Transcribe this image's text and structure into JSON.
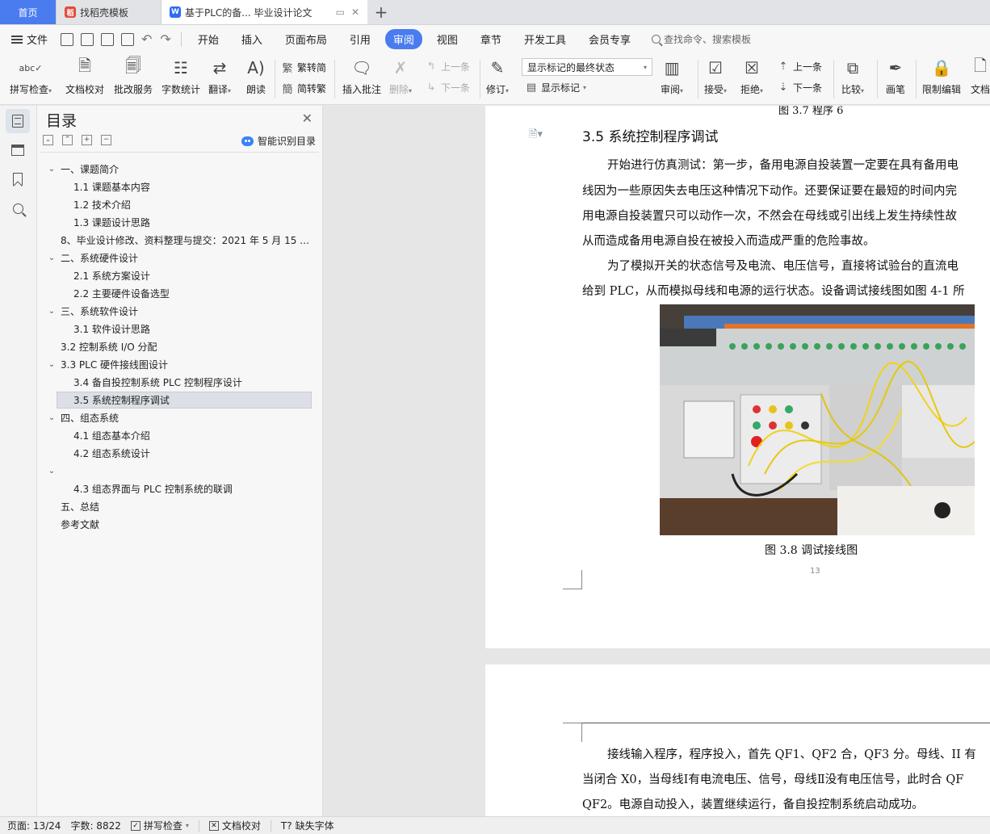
{
  "tabs": {
    "home": "首页",
    "template": "找稻壳模板",
    "document": "基于PLC的备... 毕业设计论文",
    "template_icon": "daoke-logo-icon",
    "document_icon": "wps-writer-icon"
  },
  "menu": {
    "file": "文件",
    "items": [
      "开始",
      "插入",
      "页面布局",
      "引用",
      "审阅",
      "视图",
      "章节",
      "开发工具",
      "会员专享"
    ],
    "active": "审阅",
    "search": "查找命令、搜索模板"
  },
  "ribbon": {
    "spell_check": "拼写检查",
    "doc_proof": "文档校对",
    "batch_review": "批改服务",
    "word_count": "字数统计",
    "translate": "翻译",
    "read_aloud": "朗读",
    "to_traditional": "繁转简",
    "to_simplified": "简转繁",
    "insert_comment": "插入批注",
    "delete": "删除",
    "prev_comment": "上一条",
    "next_comment": "下一条",
    "track_changes": "修订",
    "markup_state": "显示标记的最终状态",
    "show_markup": "显示标记",
    "review": "审阅",
    "accept": "接受",
    "reject": "拒绝",
    "prev_change": "上一条",
    "next_change": "下一条",
    "compare": "比较",
    "ink": "画笔",
    "restrict_edit": "限制编辑",
    "doc_rights": "文档"
  },
  "toc": {
    "title": "目录",
    "ai_button": "智能识别目录",
    "items": [
      {
        "text": "一、课题简介",
        "level": 1,
        "expand": "open"
      },
      {
        "text": "1.1  课题基本内容",
        "level": 2
      },
      {
        "text": "1.2  技术介绍",
        "level": 2
      },
      {
        "text": "1.3  课题设计思路",
        "level": 2
      },
      {
        "text": "8、毕业设计修改、资料整理与提交：2021 年 5 月 15 …",
        "level": 1
      },
      {
        "text": "二、系统硬件设计",
        "level": 1,
        "expand": "open"
      },
      {
        "text": "2.1  系统方案设计",
        "level": 2
      },
      {
        "text": "2.2  主要硬件设备选型",
        "level": 2
      },
      {
        "text": "三、系统软件设计",
        "level": 1,
        "expand": "open"
      },
      {
        "text": "3.1  软件设计思路",
        "level": 2
      },
      {
        "text": "3.2  控制系统 I/O 分配",
        "level": 1
      },
      {
        "text": "3.3 PLC 硬件接线图设计",
        "level": 1,
        "expand": "open"
      },
      {
        "text": "3.4 备自投控制系统 PLC 控制程序设计",
        "level": 2
      },
      {
        "text": "3.5 系统控制程序调试",
        "level": 2,
        "selected": true
      },
      {
        "text": "四、组态系统",
        "level": 1,
        "expand": "open"
      },
      {
        "text": "4.1  组态基本介绍",
        "level": 2
      },
      {
        "text": "4.2 组态系统设计",
        "level": 2
      },
      {
        "text": "",
        "level": 1,
        "expand": "open"
      },
      {
        "text": "4.3 组态界面与 PLC 控制系统的联调",
        "level": 2
      },
      {
        "text": "五、总结",
        "level": 1
      },
      {
        "text": "参考文献",
        "level": 1
      }
    ]
  },
  "document": {
    "prev_caption": "图 3.7  程序 6",
    "heading": "3.5 系统控制程序调试",
    "page1_lines": [
      "开始进行仿真测试：第一步，备用电源自投装置一定要在具有备用电",
      "线因为一些原因失去电压这种情况下动作。还要保证要在最短的时间内完",
      "用电源自投装置只可以动作一次，不然会在母线或引出线上发生持续性故",
      "从而造成备用电源自投在被投入而造成严重的危险事故。",
      "为了模拟开关的状态信号及电流、电压信号，直接将试验台的直流电",
      "给到 PLC，从而模拟母线和电源的运行状态。设备调试接线图如图 4-1 所"
    ],
    "figure_caption": "图 3.8  调试接线图",
    "page_number": "13",
    "page2_lines": [
      "接线输入程序，程序投入，首先 QF1、QF2 合，QF3 分。母线、II 有",
      "当闭合 X0，当母线Ⅰ有电流电压、信号，母线Ⅱ没有电压信号，此时合 QF",
      "QF2。电源自动投入，装置继续运行，备自投控制系统启动成功。"
    ]
  },
  "status": {
    "page": "页面: 13/24",
    "words": "字数: 8822",
    "spell": "拼写检查",
    "proof": "文档校对",
    "missing_font": "缺失字体"
  }
}
